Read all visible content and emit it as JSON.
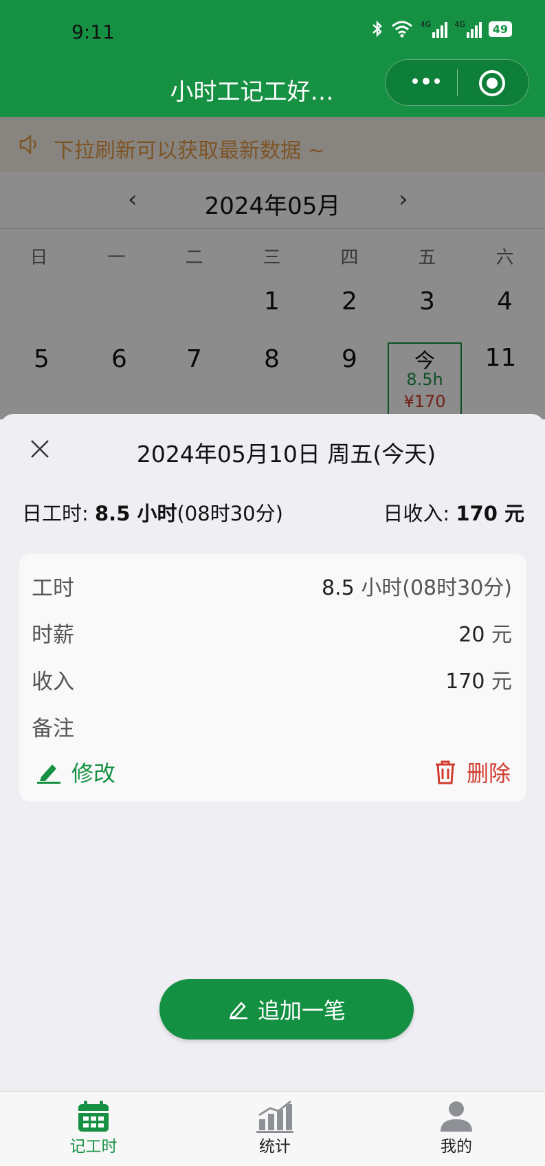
{
  "status": {
    "time": "9:11",
    "signal1": "4G",
    "signal2": "4G",
    "battery": "49"
  },
  "nav": {
    "title": "小时工记工好…"
  },
  "notice": {
    "text": "下拉刷新可以获取最新数据 ~"
  },
  "calendar": {
    "month_label": "2024年05月",
    "weekdays": [
      "日",
      "一",
      "二",
      "三",
      "四",
      "五",
      "六"
    ],
    "week1": [
      "1",
      "2",
      "3",
      "4"
    ],
    "week2": [
      "5",
      "6",
      "7",
      "8",
      "9",
      "11"
    ],
    "today": {
      "char": "今",
      "hours": "8.5h",
      "money": "¥170"
    }
  },
  "sheet": {
    "title": "2024年05月10日 周五(今天)",
    "day_hours_label": "日工时:",
    "day_hours_value": "8.5 小时",
    "day_hours_detail": "(08时30分)",
    "day_income_label": "日收入:",
    "day_income_value": "170 元",
    "rows": {
      "hours_label": "工时",
      "hours_num": "8.5",
      "hours_unit": "小时(08时30分)",
      "wage_label": "时薪",
      "wage_num": "20",
      "wage_unit": "元",
      "income_label": "收入",
      "income_num": "170",
      "income_unit": "元",
      "note_label": "备注"
    },
    "edit_label": "修改",
    "delete_label": "删除"
  },
  "add_button": {
    "label": "追加一笔"
  },
  "tabs": [
    {
      "label": "记工时",
      "active": true
    },
    {
      "label": "统计",
      "active": false
    },
    {
      "label": "我的",
      "active": false
    }
  ],
  "colors": {
    "brand_green": "#169143",
    "danger_red": "#d13b2e",
    "notice_orange": "#e49a45"
  }
}
